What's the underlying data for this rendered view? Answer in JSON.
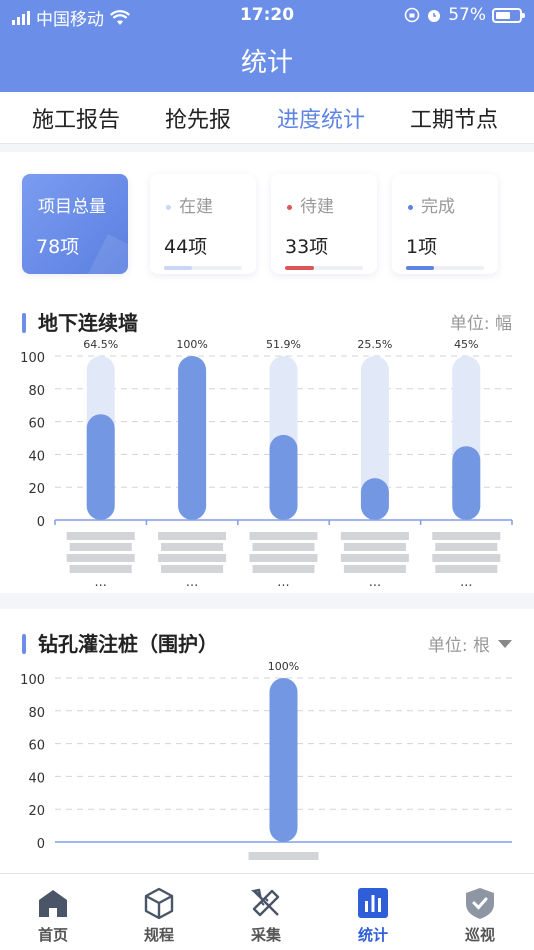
{
  "status_bar": {
    "carrier": "中国移动",
    "time": "17:20",
    "battery": "57%"
  },
  "header": {
    "title": "统计"
  },
  "tabs": [
    {
      "label": "施工报告",
      "active": false
    },
    {
      "label": "抢先报",
      "active": false
    },
    {
      "label": "进度统计",
      "active": true
    },
    {
      "label": "工期节点",
      "active": false
    }
  ],
  "summary": {
    "total": {
      "label": "项目总量",
      "value": "78项"
    },
    "cards": [
      {
        "label": "在建",
        "value": "44项",
        "progress": 0.36,
        "color": "#c9d6f6"
      },
      {
        "label": "待建",
        "value": "33项",
        "progress": 0.37,
        "color": "#e05555"
      },
      {
        "label": "完成",
        "value": "1项",
        "progress": 0.36,
        "color": "#5d84e2"
      }
    ]
  },
  "section1": {
    "title": "地下连续墙",
    "unit": "单位: 幅"
  },
  "section2": {
    "title": "钻孔灌注桩（围护）",
    "unit": "单位: 根"
  },
  "chart_data": [
    {
      "type": "bar",
      "yticks": [
        "100",
        "80",
        "60",
        "40",
        "20",
        "0"
      ],
      "ylim": [
        0,
        100
      ],
      "grid": true,
      "values": [
        64.5,
        100,
        51.9,
        25.5,
        45
      ],
      "labels": [
        "64.5%",
        "100%",
        "51.9%",
        "25.5%",
        "45%"
      ],
      "ellipsis": "..."
    },
    {
      "type": "bar",
      "yticks": [
        "100",
        "80",
        "60",
        "40",
        "20",
        "0"
      ],
      "ylim": [
        0,
        100
      ],
      "grid": true,
      "values": [
        100
      ],
      "labels": [
        "100%"
      ]
    }
  ],
  "nav": [
    {
      "label": "首页",
      "icon": "home-icon",
      "active": false
    },
    {
      "label": "规程",
      "icon": "cube-icon",
      "active": false
    },
    {
      "label": "采集",
      "icon": "ruler-pencil-icon",
      "active": false
    },
    {
      "label": "统计",
      "icon": "bar-chart-icon",
      "active": true
    },
    {
      "label": "巡视",
      "icon": "shield-check-icon",
      "active": false
    }
  ]
}
